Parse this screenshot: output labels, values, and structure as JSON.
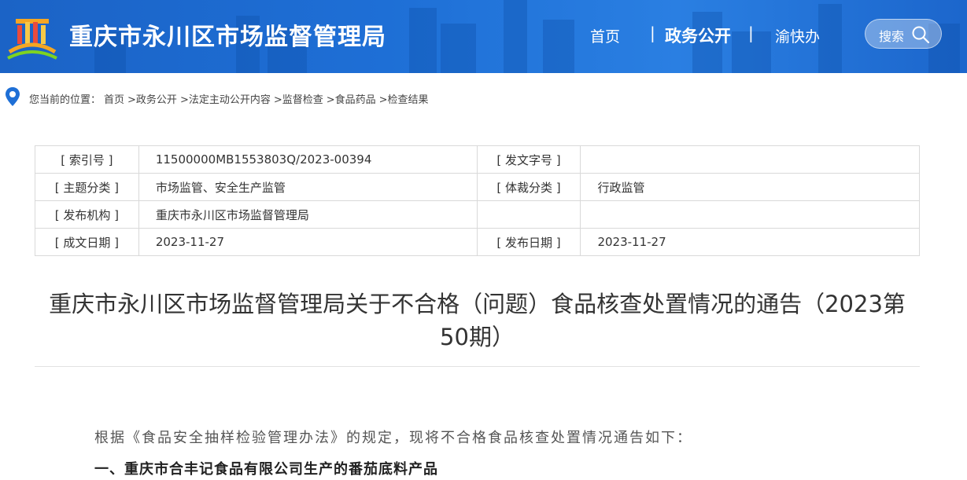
{
  "header": {
    "site_title": "重庆市永川区市场监督管理局",
    "nav": {
      "home": "首页",
      "affairs": "政务公开",
      "yukuaiban": "渝快办",
      "separator": "|"
    },
    "search_label": "搜索",
    "colors": {
      "header_bg": "#1e6fd6",
      "text": "#ffffff"
    }
  },
  "breadcrumb": {
    "prefix": "您当前的位置：",
    "items": [
      "首页",
      ">政务公开",
      ">法定主动公开内容",
      ">监督检查",
      ">食品药品",
      ">检查结果"
    ]
  },
  "meta": {
    "rows": [
      {
        "label1": "[ 索引号 ]",
        "value1": "11500000MB1553803Q/2023-00394",
        "label2": "[ 发文字号 ]",
        "value2": ""
      },
      {
        "label1": "[ 主题分类 ]",
        "value1": "市场监管、安全生产监管",
        "label2": "[ 体裁分类 ]",
        "value2": "行政监管"
      },
      {
        "label1": "[ 发布机构 ]",
        "value1": "重庆市永川区市场监督管理局",
        "label2": "",
        "value2": ""
      },
      {
        "label1": "[ 成文日期 ]",
        "value1": "2023-11-27",
        "label2": "[ 发布日期 ]",
        "value2": "2023-11-27"
      }
    ]
  },
  "article": {
    "title_line1": "重庆市永川区市场监督管理局关于不合格（问题）食品核查处置情况的通告（2023第",
    "title_line2": "50期）",
    "intro": "根据《食品安全抽样检验管理办法》的规定，现将不合格食品核查处置情况通告如下：",
    "section1": "一、重庆市合丰记食品有限公司生产的番茄底料产品"
  }
}
